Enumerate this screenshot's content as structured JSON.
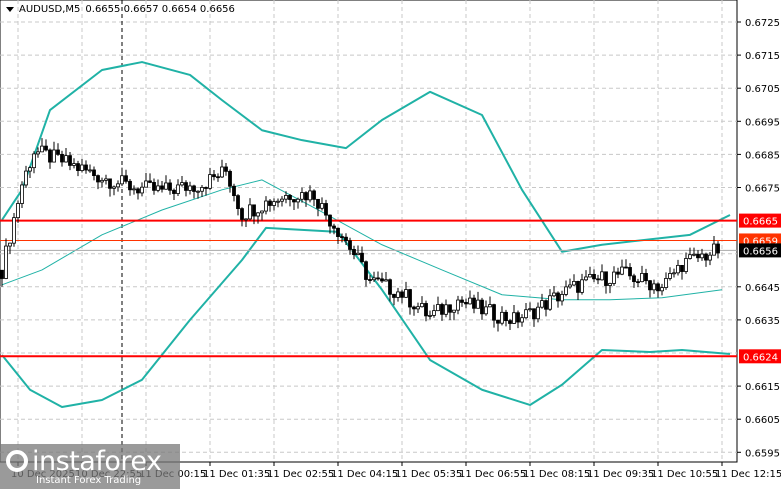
{
  "header": {
    "symbol": "AUDUSD,M5",
    "ohlc": "0.6655 0.6657 0.6654 0.6656"
  },
  "logo": {
    "name": "instaforex",
    "tagline": "Instant Forex Trading"
  },
  "colors": {
    "bull": "#000000",
    "band": "#20b2a6",
    "level": "#ff0000",
    "current": "#000000",
    "ask": "#ff3300"
  },
  "chart_data": {
    "type": "candlestick",
    "y_axis": {
      "min": 0.6592,
      "max": 0.6732,
      "ticks": [
        "0.6725",
        "0.6715",
        "0.6705",
        "0.6695",
        "0.6685",
        "0.6675",
        "0.6645",
        "0.6635",
        "0.6615",
        "0.6605",
        "0.6595"
      ]
    },
    "x_axis": {
      "bars": 184,
      "labels": [
        {
          "bar": 1,
          "text": "10 Dec 2025"
        },
        {
          "bar": 17,
          "text": "10 Dec 22:55"
        },
        {
          "bar": 33,
          "text": "11 Dec 00:15"
        },
        {
          "bar": 49,
          "text": "11 Dec 01:35"
        },
        {
          "bar": 65,
          "text": "11 Dec 02:55"
        },
        {
          "bar": 81,
          "text": "11 Dec 04:15"
        },
        {
          "bar": 97,
          "text": "11 Dec 05:35"
        },
        {
          "bar": 113,
          "text": "11 Dec 06:55"
        },
        {
          "bar": 129,
          "text": "11 Dec 08:15"
        },
        {
          "bar": 145,
          "text": "11 Dec 09:35"
        },
        {
          "bar": 161,
          "text": "11 Dec 10:55"
        },
        {
          "bar": 177,
          "text": "11 Dec 12:15"
        }
      ]
    },
    "close_keypoints": [
      [
        0,
        0.665
      ],
      [
        5,
        0.6676
      ],
      [
        8,
        0.6686
      ],
      [
        15,
        0.6683
      ],
      [
        25,
        0.6678
      ],
      [
        33,
        0.6675
      ],
      [
        40,
        0.6674
      ],
      [
        50,
        0.6676
      ],
      [
        56,
        0.668
      ],
      [
        60,
        0.6667
      ],
      [
        65,
        0.667
      ],
      [
        72,
        0.6673
      ],
      [
        78,
        0.6673
      ],
      [
        81,
        0.6667
      ],
      [
        86,
        0.6659
      ],
      [
        92,
        0.6647
      ],
      [
        100,
        0.6643
      ],
      [
        107,
        0.6636
      ],
      [
        114,
        0.6641
      ],
      [
        120,
        0.6638
      ],
      [
        128,
        0.6635
      ],
      [
        132,
        0.6637
      ],
      [
        140,
        0.6643
      ],
      [
        145,
        0.6646
      ],
      [
        155,
        0.6649
      ],
      [
        165,
        0.6645
      ],
      [
        170,
        0.6652
      ],
      [
        179,
        0.6656
      ]
    ],
    "bollinger_upper": [
      [
        0,
        0.66652
      ],
      [
        5,
        0.66743
      ],
      [
        12,
        0.66984
      ],
      [
        25,
        0.67105
      ],
      [
        35,
        0.67129
      ],
      [
        47,
        0.6709
      ],
      [
        55,
        0.67014
      ],
      [
        65,
        0.66923
      ],
      [
        75,
        0.66893
      ],
      [
        86,
        0.66869
      ],
      [
        95,
        0.66954
      ],
      [
        107,
        0.67039
      ],
      [
        120,
        0.66969
      ],
      [
        130,
        0.66743
      ],
      [
        140,
        0.66556
      ],
      [
        150,
        0.66577
      ],
      [
        172,
        0.66607
      ],
      [
        182,
        0.66667
      ]
    ],
    "bollinger_lower": [
      [
        0,
        0.66244
      ],
      [
        7,
        0.66139
      ],
      [
        15,
        0.66087
      ],
      [
        25,
        0.66108
      ],
      [
        35,
        0.66169
      ],
      [
        47,
        0.6635
      ],
      [
        60,
        0.66531
      ],
      [
        66,
        0.66628
      ],
      [
        75,
        0.66622
      ],
      [
        84,
        0.66616
      ],
      [
        95,
        0.66441
      ],
      [
        107,
        0.66229
      ],
      [
        120,
        0.66139
      ],
      [
        132,
        0.66093
      ],
      [
        140,
        0.66154
      ],
      [
        150,
        0.66259
      ],
      [
        162,
        0.66253
      ],
      [
        170,
        0.66259
      ],
      [
        182,
        0.66247
      ]
    ],
    "moving_average": [
      [
        0,
        0.66456
      ],
      [
        10,
        0.66501
      ],
      [
        25,
        0.66607
      ],
      [
        40,
        0.66682
      ],
      [
        55,
        0.66743
      ],
      [
        65,
        0.66773
      ],
      [
        80,
        0.66676
      ],
      [
        95,
        0.66577
      ],
      [
        110,
        0.66501
      ],
      [
        125,
        0.66426
      ],
      [
        140,
        0.66411
      ],
      [
        152,
        0.66411
      ],
      [
        165,
        0.66417
      ],
      [
        180,
        0.66441
      ]
    ],
    "levels": [
      {
        "price": 0.6665,
        "label": "0.6665"
      },
      {
        "price": 0.6624,
        "label": "0.6624"
      }
    ],
    "ask": {
      "price": 0.6659,
      "label": "0.6659"
    },
    "current": {
      "price": 0.6656,
      "label": "0.6656"
    },
    "crosshair_bar": 30
  }
}
